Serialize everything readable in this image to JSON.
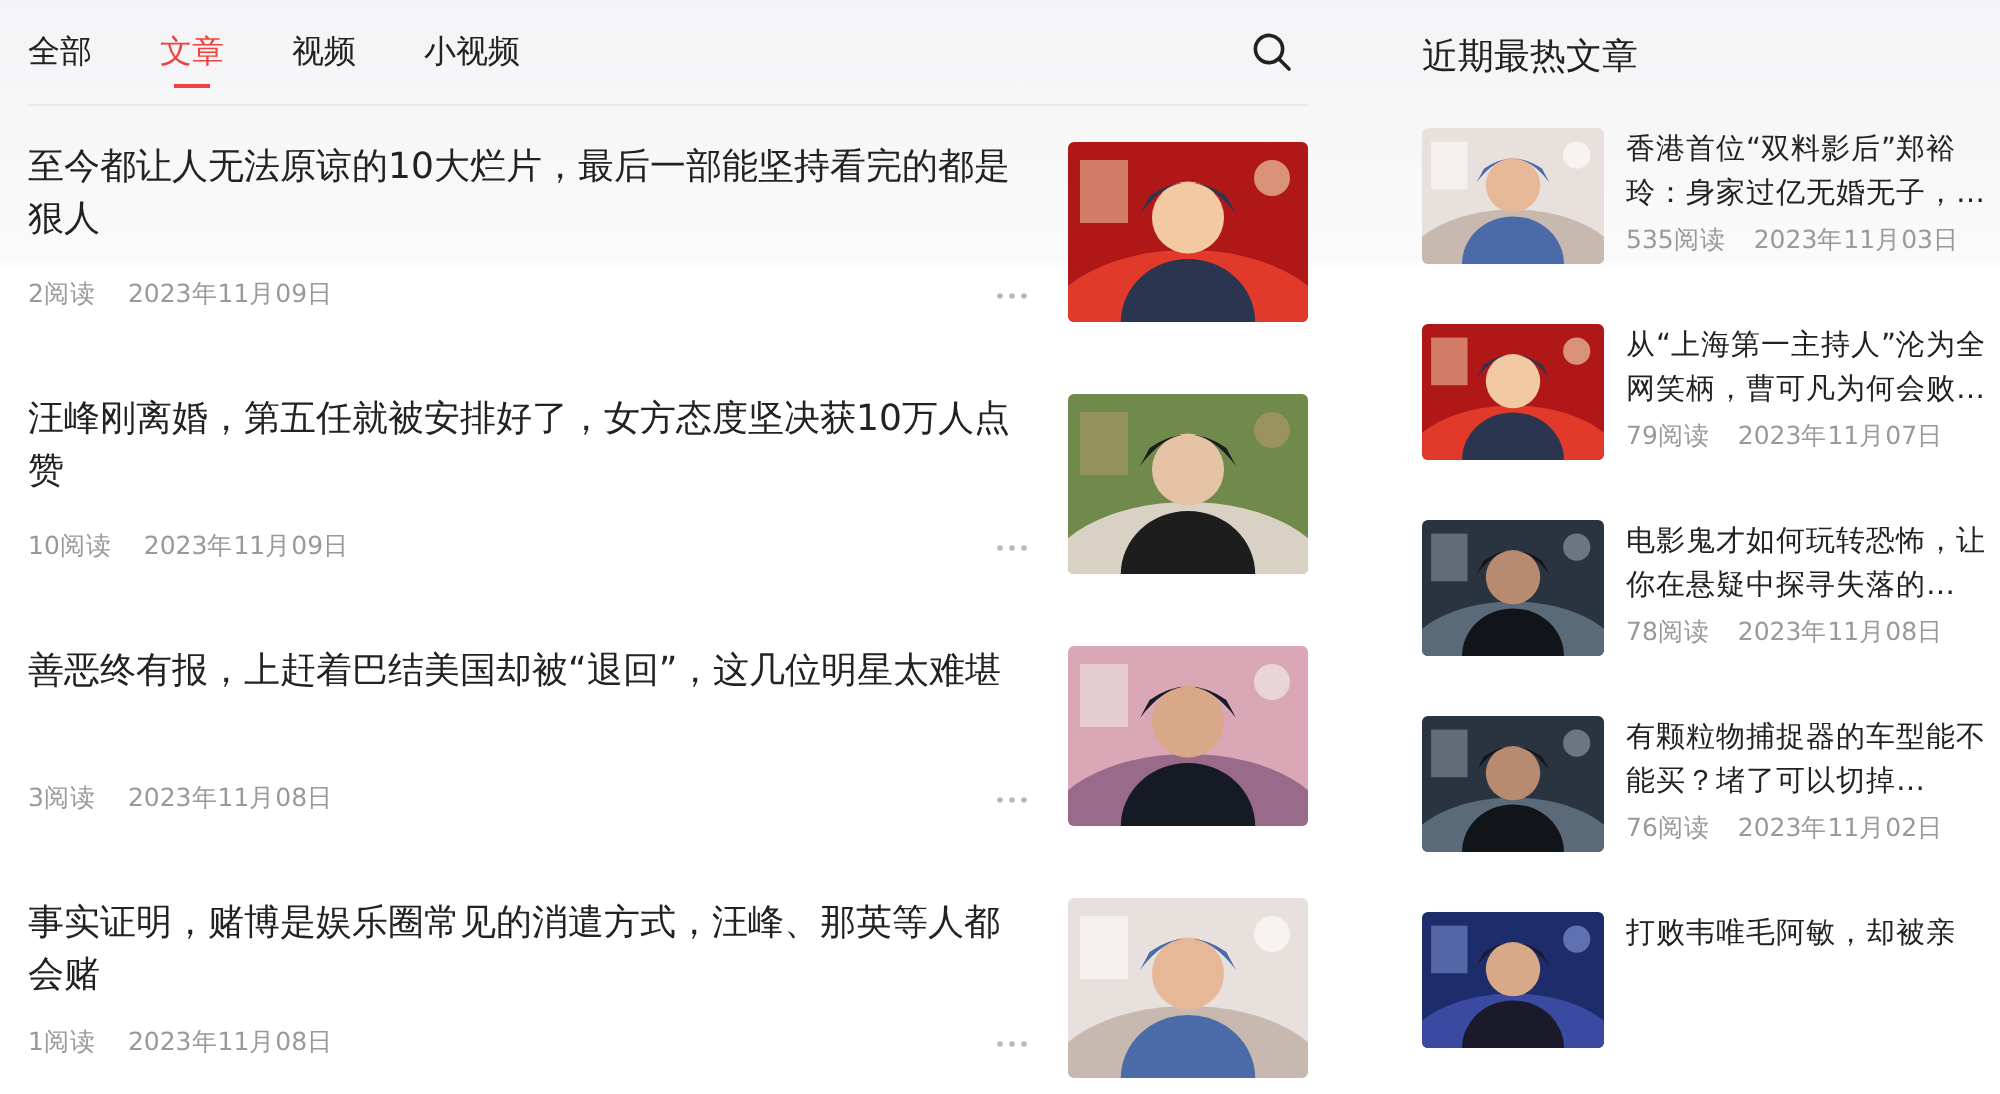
{
  "tabs": [
    {
      "label": "全部",
      "selected": false
    },
    {
      "label": "文章",
      "selected": true
    },
    {
      "label": "视频",
      "selected": false
    },
    {
      "label": "小视频",
      "selected": false
    }
  ],
  "articles": [
    {
      "title": "至今都让人无法原谅的10大烂片，最后一部能坚持看完的都是狠人",
      "reads": "2阅读",
      "date": "2023年11月09日"
    },
    {
      "title": "汪峰刚离婚，第五任就被安排好了，女方态度坚决获10万人点赞",
      "reads": "10阅读",
      "date": "2023年11月09日"
    },
    {
      "title": "善恶终有报，上赶着巴结美国却被“退回”，这几位明星太难堪",
      "reads": "3阅读",
      "date": "2023年11月08日"
    },
    {
      "title": "事实证明，赌博是娱乐圈常见的消遣方式，汪峰、那英等人都会赌",
      "reads": "1阅读",
      "date": "2023年11月08日"
    }
  ],
  "sidebar": {
    "heading": "近期最热文章",
    "items": [
      {
        "title": "香港首位“双料影后”郑裕玲：身家过亿无婚无子，…",
        "reads": "535阅读",
        "date": "2023年11月03日"
      },
      {
        "title": "从“上海第一主持人”沦为全网笑柄，曹可凡为何会败…",
        "reads": "79阅读",
        "date": "2023年11月07日"
      },
      {
        "title": "电影鬼才如何玩转恐怖，让你在悬疑中探寻失落的…",
        "reads": "78阅读",
        "date": "2023年11月08日"
      },
      {
        "title": "有颗粒物捕捉器的车型能不能买？堵了可以切掉…",
        "reads": "76阅读",
        "date": "2023年11月02日"
      },
      {
        "title": "打败韦唯毛阿敏，却被亲"
      }
    ]
  }
}
